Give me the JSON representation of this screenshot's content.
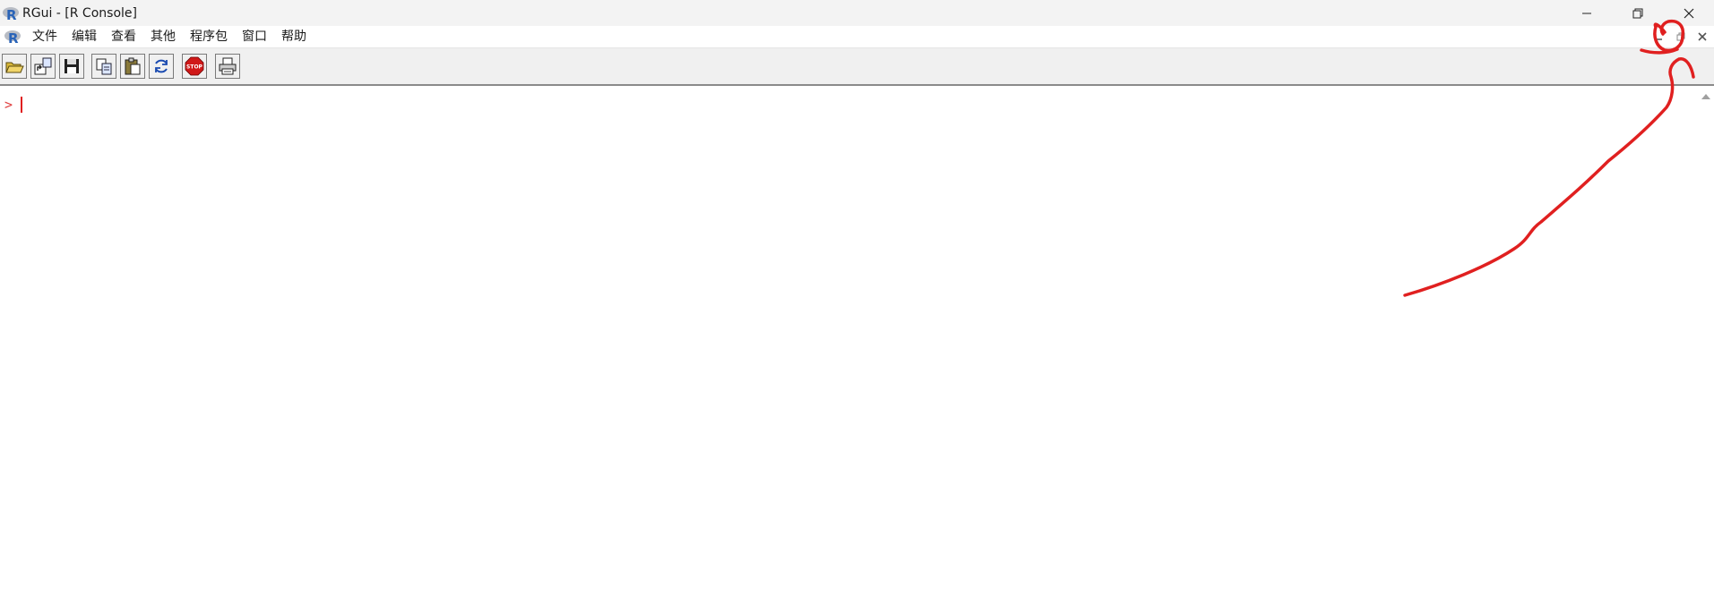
{
  "window": {
    "title": "RGui - [R Console]",
    "icons": [
      "r-logo-icon",
      "minimize-icon",
      "restore-icon",
      "close-icon"
    ]
  },
  "menubar": {
    "items": [
      {
        "label": "文件"
      },
      {
        "label": "编辑"
      },
      {
        "label": "查看"
      },
      {
        "label": "其他"
      },
      {
        "label": "程序包"
      },
      {
        "label": "窗口"
      },
      {
        "label": "帮助"
      }
    ]
  },
  "toolbar": {
    "buttons": [
      "open-script-icon",
      "load-workspace-icon",
      "save-workspace-icon",
      "copy-icon",
      "paste-icon",
      "copy-paste-icon",
      "stop-icon",
      "print-icon"
    ],
    "stop_label": "STOP"
  },
  "console": {
    "prompt": ">"
  },
  "colors": {
    "prompt": "#e04040",
    "annotation": "#e02020",
    "titlebar": "#f3f3f3",
    "toolbar": "#f0f0f0"
  }
}
